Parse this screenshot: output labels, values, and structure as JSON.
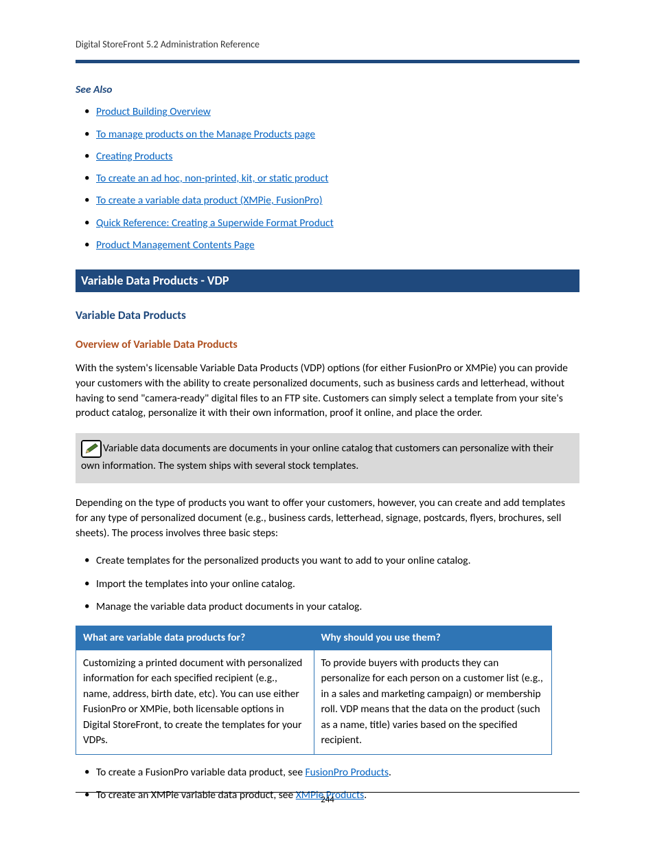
{
  "header": {
    "running": "Digital StoreFront 5.2 Administration Reference"
  },
  "seeAlso": {
    "heading": "See Also",
    "links": [
      "Product Building Overview",
      "To manage products on the Manage Products page",
      "Creating Products",
      "To create an ad hoc, non-printed, kit,  or static product",
      "To create a variable data product (XMPie, FusionPro)",
      "Quick Reference: Creating a Superwide Format Product",
      "Product Management Contents Page"
    ]
  },
  "banner": "Variable Data Products - VDP",
  "h2": "Variable Data Products",
  "h3": "Overview of Variable Data Products",
  "para1": "With the system's licensable Variable Data Products (VDP) options (for either FusionPro or XMPie) you can provide your customers with the ability to create personalized documents, such as business cards and letterhead, without having to send \"camera-ready\" digital files to an FTP site. Customers can simply select a template from your site's product catalog, personalize it with their own information, proof it online, and place the order.",
  "noteText": "Variable data documents are documents in your online catalog that customers can personalize with their own information. The system ships with several stock templates.",
  "para2": "Depending on the type of products you want to offer your customers, however, you can create and add templates for any type of personalized document (e.g., business cards, letterhead, signage, postcards, flyers, brochures, sell sheets). The process involves three basic steps:",
  "steps": [
    "Create templates for the personalized products you want to add to your online catalog.",
    "Import the templates into your online catalog.",
    "Manage the variable data product documents in your catalog."
  ],
  "table": {
    "headers": [
      "What are variable data products for?",
      "Why should you use them?"
    ],
    "cells": [
      "Customizing a printed document with personalized information for each specified recipient (e.g., name, address, birth date, etc). You can use either FusionPro or XMPie, both licensable options in Digital StoreFront, to create the templates for your VDPs.",
      "To provide buyers with products they can personalize for each person on a customer list (e.g., in a sales and marketing campaign) or membership roll. VDP means that the data on the product (such as a name, title) varies based on the specified recipient."
    ]
  },
  "closing": {
    "item1_prefix": "To create a FusionPro variable data product, see ",
    "item1_link": "FusionPro Products",
    "item1_suffix": ".",
    "item2_prefix": "To create an XMPie variable data product, see ",
    "item2_link": "XMPie Products",
    "item2_suffix": "."
  },
  "pageNumber": "244"
}
